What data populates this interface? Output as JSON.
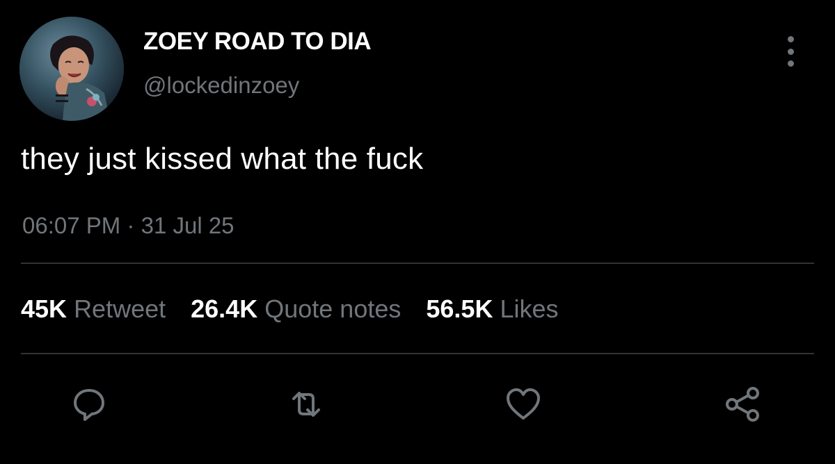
{
  "author": {
    "display_name": "ZOEY ROAD TO DIA",
    "handle": "@lockedinzoey",
    "avatar_icon": "profile-avatar-icon"
  },
  "tweet": {
    "text": "they just kissed what the fuck",
    "time": "06:07 PM",
    "separator": "·",
    "date": "31 Jul 25"
  },
  "stats": [
    {
      "count": "45K",
      "label": "Retweet"
    },
    {
      "count": "26.4K",
      "label": "Quote notes"
    },
    {
      "count": "56.5K",
      "label": "Likes"
    }
  ],
  "actions": [
    {
      "name": "reply",
      "icon": "reply-icon"
    },
    {
      "name": "retweet",
      "icon": "retweet-icon"
    },
    {
      "name": "like",
      "icon": "heart-icon"
    },
    {
      "name": "share",
      "icon": "share-icon"
    }
  ],
  "colors": {
    "background": "#000000",
    "primary_text": "#ffffff",
    "secondary_text": "#71767b",
    "divider": "#2f3336"
  }
}
